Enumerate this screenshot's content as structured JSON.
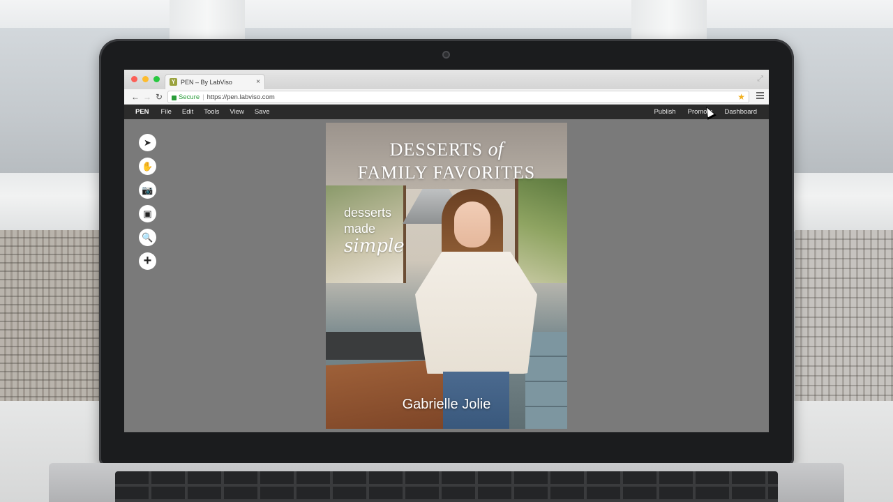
{
  "browser": {
    "tab_title": "PEN – By LabViso",
    "tab_close": "×",
    "favicon_letter": "Y",
    "secure_label": "Secure",
    "url": "https://pen.labviso.com"
  },
  "app": {
    "brand": "PEN",
    "menu_left": [
      "File",
      "Edit",
      "Tools",
      "View",
      "Save"
    ],
    "menu_right": [
      "Publish",
      "Promote",
      "Dashboard"
    ]
  },
  "tools": [
    {
      "name": "select-tool",
      "icon": "pointer-icon",
      "glyph": "➤"
    },
    {
      "name": "pan-tool",
      "icon": "hand-icon",
      "glyph": "✋"
    },
    {
      "name": "camera-tool",
      "icon": "camera-icon",
      "glyph": "📷"
    },
    {
      "name": "media-tool",
      "icon": "film-icon",
      "glyph": "▣"
    },
    {
      "name": "zoom-tool",
      "icon": "search-icon",
      "glyph": "🔍"
    },
    {
      "name": "add-tool",
      "icon": "plus-icon",
      "glyph": "+"
    }
  ],
  "cover": {
    "title_line1_a": "DESSERTS",
    "title_line1_of": "of",
    "title_line2": "FAMILY FAVORITES",
    "tagline_line1": "desserts",
    "tagline_line2": "made",
    "tagline_script": "simple",
    "author": "Gabrielle Jolie"
  }
}
